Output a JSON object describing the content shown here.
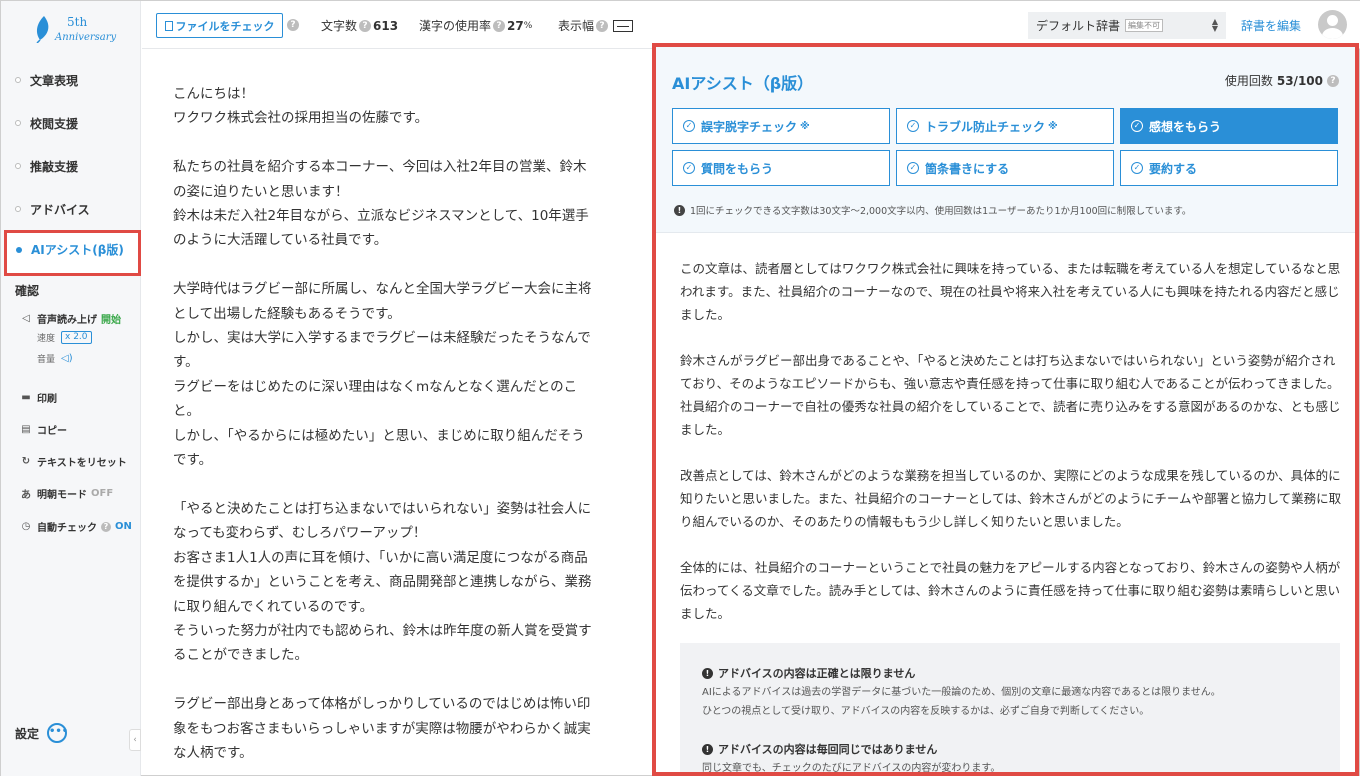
{
  "logo": {
    "num": "5th",
    "text": "Anniversary"
  },
  "sidebar": {
    "items": [
      {
        "label": "文章表現"
      },
      {
        "label": "校閲支援"
      },
      {
        "label": "推敲支援"
      },
      {
        "label": "アドバイス"
      }
    ],
    "active_item": "AIアシスト(β版)",
    "section_title": "確認",
    "read_aloud": {
      "label": "音声読み上げ",
      "status": "開始",
      "speed_label": "速度",
      "speed_value": "x 2.0",
      "volume_label": "音量"
    },
    "print": "印刷",
    "copy": "コピー",
    "reset": "テキストをリセット",
    "mincho": {
      "label": "明朝モード",
      "status": "OFF"
    },
    "auto_check": {
      "label": "自動チェック",
      "status": "ON"
    },
    "settings": "設定"
  },
  "toolbar": {
    "file_check": "ファイルをチェック",
    "char_count_label": "文字数",
    "char_count": "613",
    "kanji_label": "漢字の使用率",
    "kanji_value": "27",
    "kanji_unit": "%",
    "width_label": "表示幅",
    "dict_value": "デフォルト辞書",
    "dict_badge": "編集不可",
    "dict_edit": "辞書を編集"
  },
  "editor": {
    "text": "こんにちは！\nワクワク株式会社の採用担当の佐藤です。\n\n私たちの社員を紹介する本コーナー、今回は入社2年目の営業、鈴木\nの姿に迫りたいと思います！\n鈴木は未だ入社2年目ながら、立派なビジネスマンとして、10年選手\nのように大活躍している社員です。\n\n大学時代はラグビー部に所属し、なんと全国大学ラグビー大会に主将\nとして出場した経験もあるそうです。\nしかし、実は大学に入学するまでラグビーは未経験だったそうなんで\nす。\nラグビーをはじめたのに深い理由はなくmなんとなく選んだとのこ\nと。\nしかし、「やるからには極めたい」と思い、まじめに取り組んだそう\nです。\n\n「やると決めたことは打ち込まないではいられない」姿勢は社会人に\nなっても変わらず、むしろパワーアップ！\nお客さま1人1人の声に耳を傾け、「いかに高い満足度につながる商品\nを提供するか」ということを考え、商品開発部と連携しながら、業務\nに取り組んでくれているのです。\nそういった努力が社内でも認められ、鈴木は昨年度の新人賞を受賞す\nることができました。\n\nラグビー部出身とあって体格がしっかりしているのではじめは怖い印\n象をもつお客さまもいらっしゃいますが実際は物腰がやわらかく誠実\nな人柄です。"
  },
  "ai": {
    "title": "AIアシスト（β版）",
    "usage_label": "使用回数",
    "usage_value": "53/100",
    "buttons": [
      {
        "label": "誤字脱字チェック",
        "mark": "※"
      },
      {
        "label": "トラブル防止チェック",
        "mark": "※"
      },
      {
        "label": "感想をもらう",
        "mark": ""
      },
      {
        "label": "質問をもらう",
        "mark": ""
      },
      {
        "label": "箇条書きにする",
        "mark": ""
      },
      {
        "label": "要約する",
        "mark": ""
      }
    ],
    "note": "1回にチェックできる文字数は30文字〜2,000文字以内、使用回数は1ユーザーあたり1か月100回に制限しています。",
    "paragraphs": [
      "この文章は、読者層としてはワクワク株式会社に興味を持っている、または転職を考えている人を想定しているなと思われます。また、社員紹介のコーナーなので、現在の社員や将来入社を考えている人にも興味を持たれる内容だと感じました。",
      "鈴木さんがラグビー部出身であることや、「やると決めたことは打ち込まないではいられない」という姿勢が紹介されており、そのようなエピソードからも、強い意志や責任感を持って仕事に取り組む人であることが伝わってきました。社員紹介のコーナーで自社の優秀な社員の紹介をしていることで、読者に売り込みをする意図があるのかな、とも感じました。",
      "改善点としては、鈴木さんがどのような業務を担当しているのか、実際にどのような成果を残しているのか、具体的に知りたいと思いました。また、社員紹介のコーナーとしては、鈴木さんがどのようにチームや部署と協力して業務に取り組んでいるのか、そのあたりの情報ももう少し詳しく知りたいと思いました。",
      "全体的には、社員紹介のコーナーということで社員の魅力をアピールする内容となっており、鈴木さんの姿勢や人柄が伝わってくる文章でした。読み手としては、鈴木さんのように責任感を持って仕事に取り組む姿勢は素晴らしいと思いました。"
    ],
    "disclaimer1_title": "アドバイスの内容は正確とは限りません",
    "disclaimer1_text1": "AIによるアドバイスは過去の学習データに基づいた一般論のため、個別の文章に最適な内容であるとは限りません。",
    "disclaimer1_text2": "ひとつの視点として受け取り、アドバイスの内容を反映するかは、必ずご自身で判断してください。",
    "disclaimer2_title": "アドバイスの内容は毎回同じではありません",
    "disclaimer2_text1": "同じ文章でも、チェックのたびにアドバイスの内容が変わります。"
  },
  "colors": {
    "accent": "#2a8fd7",
    "highlight": "#e04a44",
    "on": "#3aa84a"
  }
}
